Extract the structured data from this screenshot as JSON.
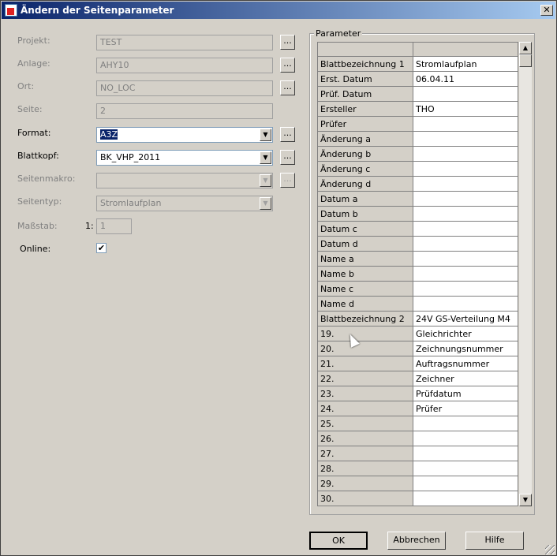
{
  "window": {
    "title": "Ändern der Seitenparameter",
    "close_glyph": "✕"
  },
  "form": {
    "projekt": {
      "label": "Projekt:",
      "value": "TEST"
    },
    "anlage": {
      "label": "Anlage:",
      "value": "AHY10"
    },
    "ort": {
      "label": "Ort:",
      "value": "NO_LOC"
    },
    "seite": {
      "label": "Seite:",
      "value": "2"
    },
    "format": {
      "label": "Format:",
      "value": "A3Z"
    },
    "blattkopf": {
      "label": "Blattkopf:",
      "value": "BK_VHP_2011"
    },
    "seitenmakro": {
      "label": "Seitenmakro:",
      "value": ""
    },
    "seitentyp": {
      "label": "Seitentyp:",
      "value": "Stromlaufplan"
    },
    "massstab": {
      "label": "Maßstab:",
      "prefix": "1:",
      "value": "1"
    },
    "online": {
      "label": "Online:",
      "checked_glyph": "✔"
    },
    "browse_label": "..."
  },
  "parameter": {
    "title": "Parameter",
    "rows": [
      [
        "Blattbezeichnung 1",
        "Stromlaufplan"
      ],
      [
        "Erst. Datum",
        "06.04.11"
      ],
      [
        "Prüf. Datum",
        ""
      ],
      [
        "Ersteller",
        "THO"
      ],
      [
        "Prüfer",
        ""
      ],
      [
        "Änderung a",
        ""
      ],
      [
        "Änderung b",
        ""
      ],
      [
        "Änderung c",
        ""
      ],
      [
        "Änderung d",
        ""
      ],
      [
        "Datum a",
        ""
      ],
      [
        "Datum b",
        ""
      ],
      [
        "Datum c",
        ""
      ],
      [
        "Datum d",
        ""
      ],
      [
        "Name a",
        ""
      ],
      [
        "Name b",
        ""
      ],
      [
        "Name c",
        ""
      ],
      [
        "Name d",
        ""
      ],
      [
        "Blattbezeichnung 2",
        "24V GS-Verteilung M4"
      ],
      [
        "19.",
        "Gleichrichter"
      ],
      [
        "20.",
        "Zeichnungsnummer"
      ],
      [
        "21.",
        "Auftragsnummer"
      ],
      [
        "22.",
        "Zeichner"
      ],
      [
        "23.",
        "Prüfdatum"
      ],
      [
        "24.",
        "Prüfer"
      ],
      [
        "25.",
        ""
      ],
      [
        "26.",
        ""
      ],
      [
        "27.",
        ""
      ],
      [
        "28.",
        ""
      ],
      [
        "29.",
        ""
      ],
      [
        "30.",
        ""
      ]
    ]
  },
  "buttons": {
    "ok": "OK",
    "cancel": "Abbrechen",
    "help": "Hilfe"
  }
}
